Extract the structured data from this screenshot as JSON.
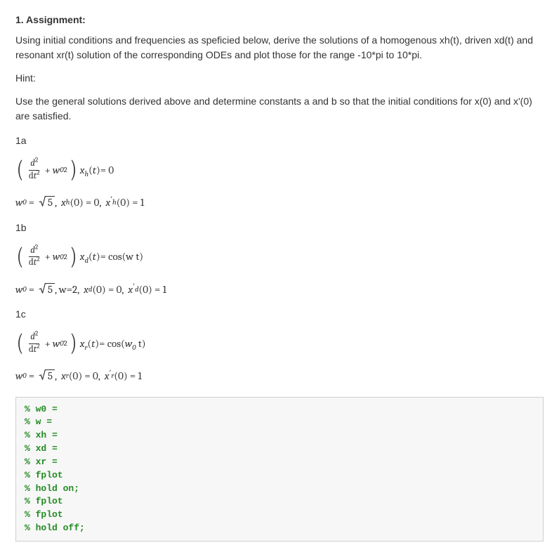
{
  "heading": "1. Assignment:",
  "intro": "Using initial conditions and frequencies as speficied below, derive the solutions of a homogenous xh(t), driven xd(t) and resonant xr(t) solution of the corresponding ODEs and plot those for the range -10*pi to 10*pi.",
  "hint_label": "Hint:",
  "hint_body": "Use the general solutions derived above and determine constants a and b so that the initial conditions for x(0) and x'(0) are satisfied.",
  "parts": {
    "a": {
      "label": "1a"
    },
    "b": {
      "label": "1b"
    },
    "c": {
      "label": "1c"
    }
  },
  "equations": {
    "a_ode": {
      "func_sub": "h",
      "rhs": " = 0"
    },
    "a_ic": {
      "w0_val": "5",
      "pieces": {
        "xval": "(0) = 0,",
        "xprime_end": "(0) = 1"
      },
      "func_sub": "h"
    },
    "b_ode": {
      "func_sub": "d",
      "rhs": " = cos(w t)"
    },
    "b_ic": {
      "w0_val": "5",
      "w_text": ", w=2,",
      "pieces": {
        "xval": "(0) = 0,",
        "xprime_end": "(0) = 1"
      },
      "func_sub": "d"
    },
    "c_ode": {
      "func_sub": "r",
      "rhs_pre": " = cos(",
      "rhs_post": " t)"
    },
    "c_ic": {
      "w0_val": "5",
      "pieces": {
        "xval": "(0) = 0,",
        "xprime_end": "(0) = 1"
      },
      "func_sub": "r"
    }
  },
  "code": {
    "lines": [
      "% w0 =",
      "% w =",
      "% xh =",
      "% xd =",
      "% xr =",
      "% fplot",
      "% hold on;",
      "% fplot",
      "% fplot",
      "% hold off;"
    ]
  }
}
